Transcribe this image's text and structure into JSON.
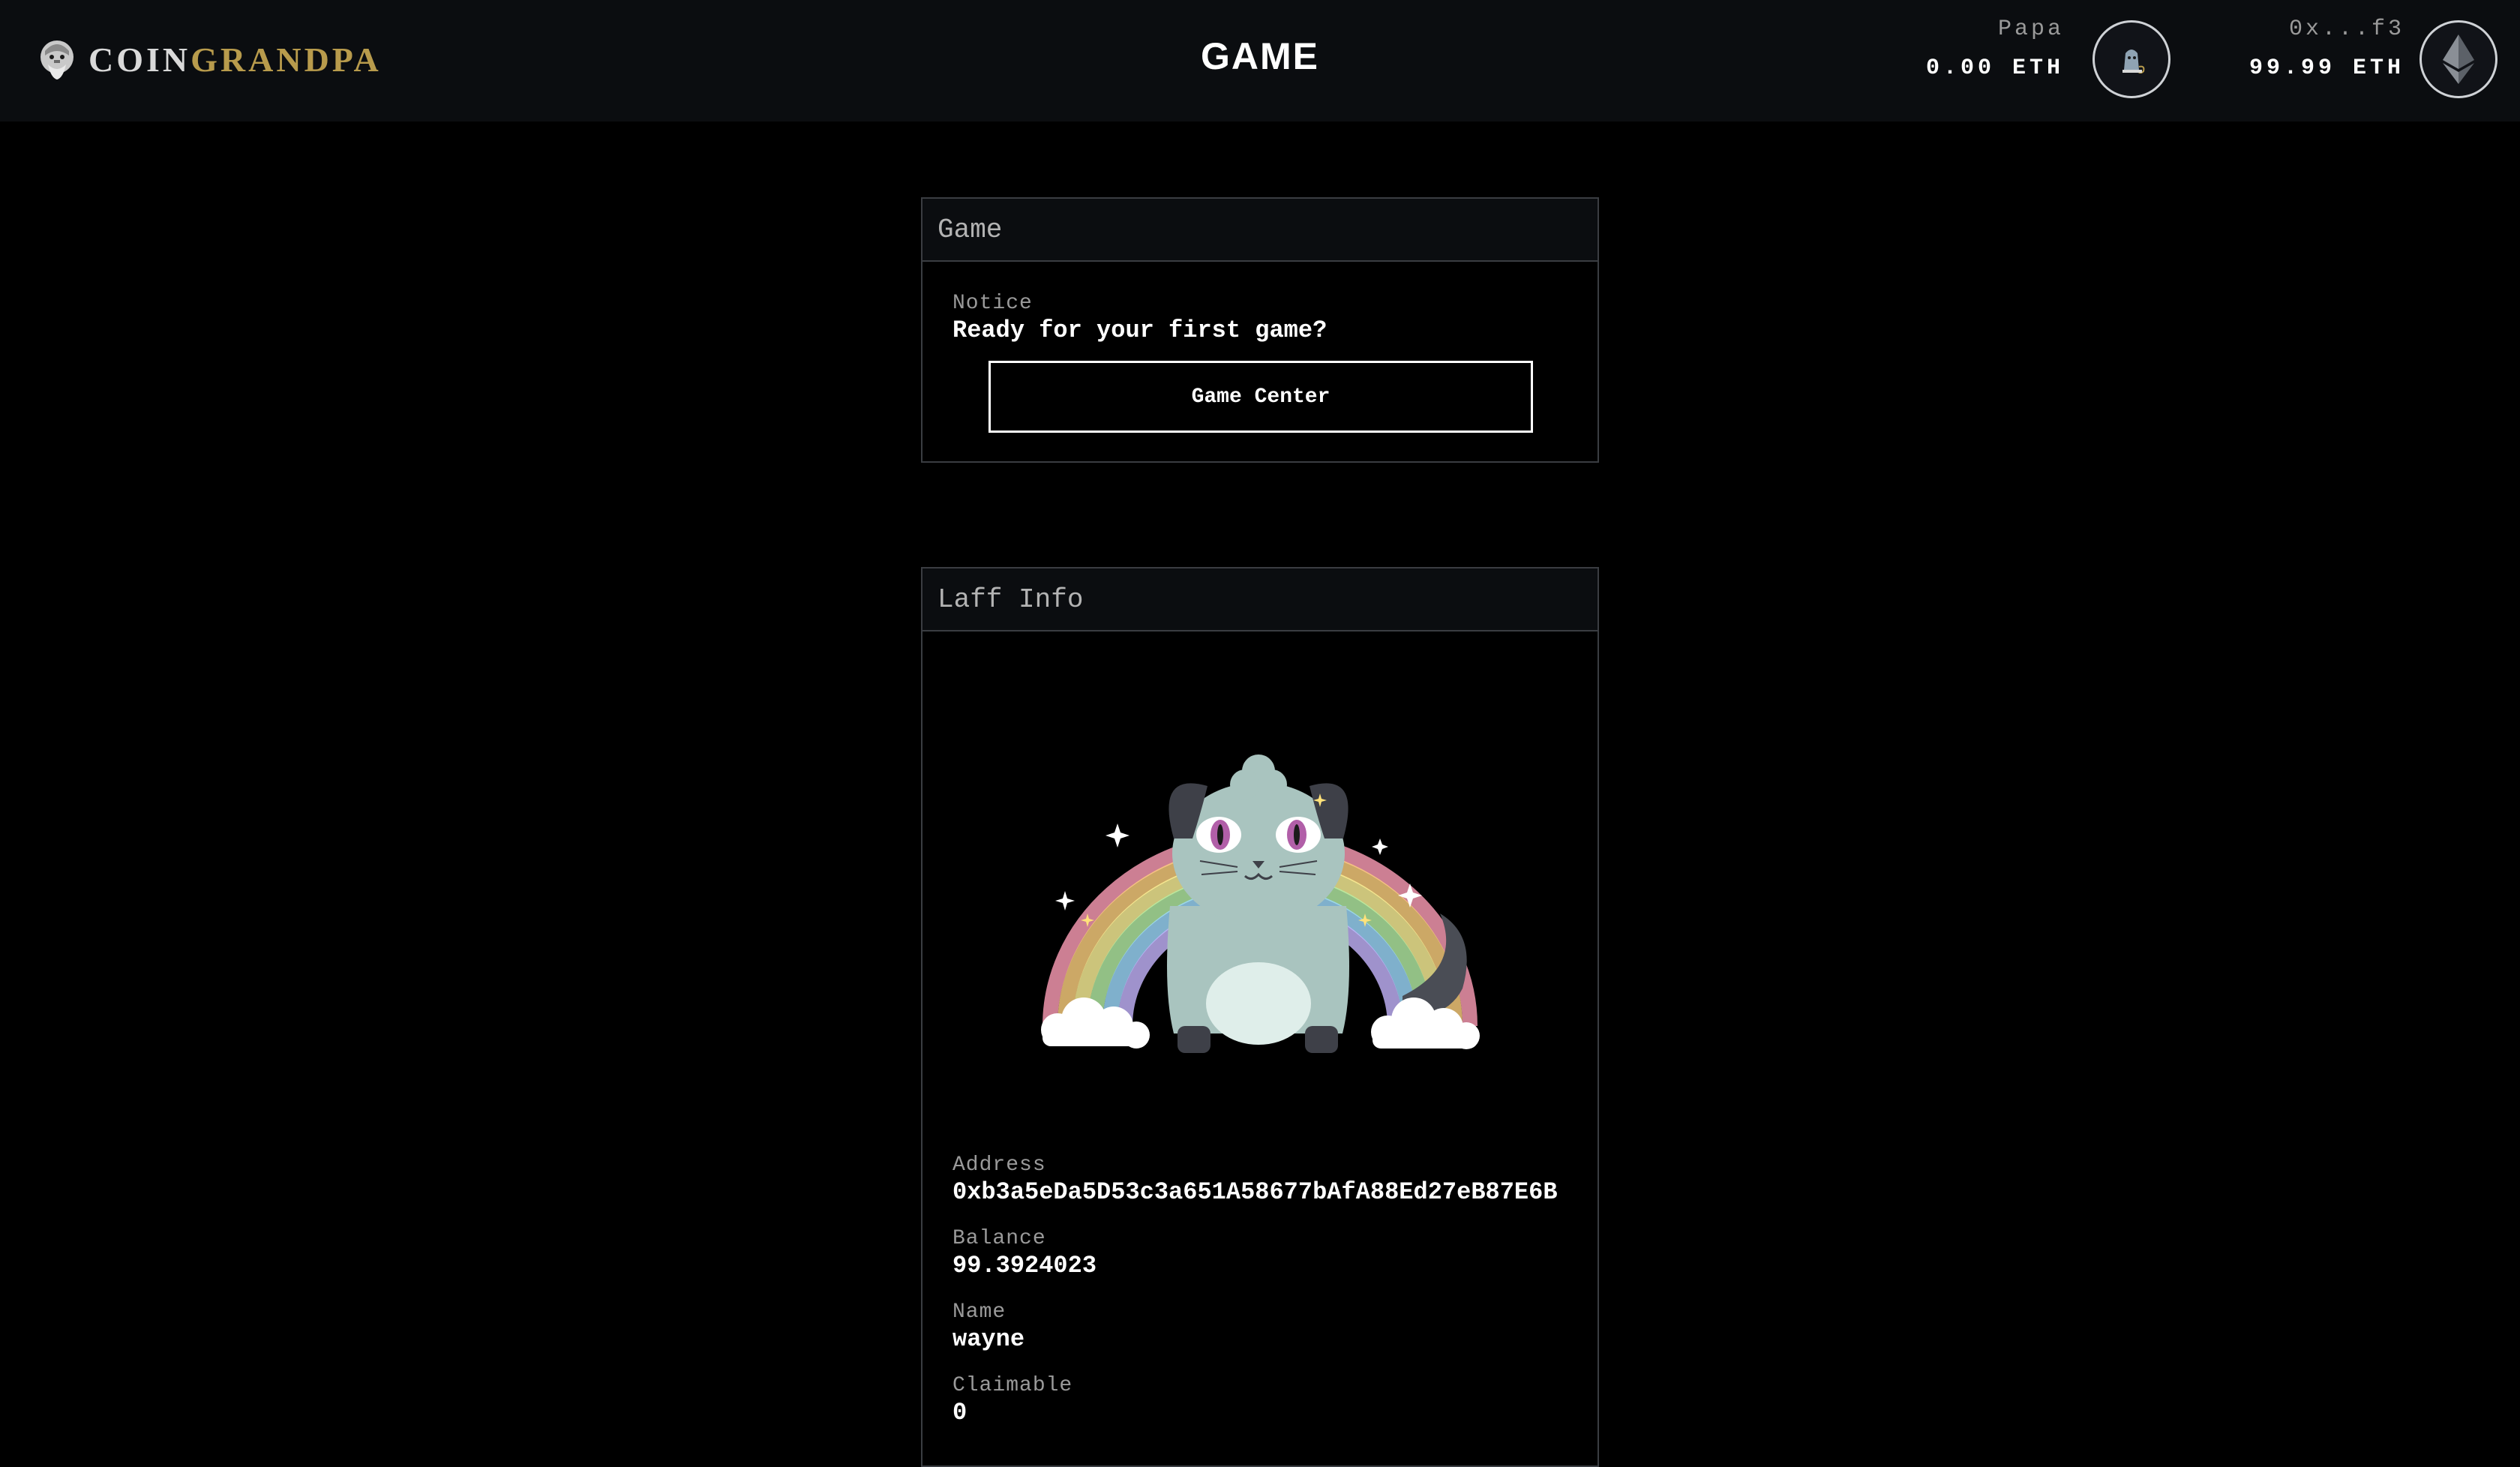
{
  "header": {
    "brand": {
      "part1": "COIN",
      "part2": "GRANDPA"
    },
    "page_title": "GAME",
    "papa_account": {
      "label": "Papa",
      "balance": "0.00 ETH",
      "icon": "papa-avatar-icon"
    },
    "wallet_account": {
      "label": "0x...f3",
      "balance": "99.99 ETH",
      "icon": "ethereum-icon"
    }
  },
  "game_card": {
    "title": "Game",
    "notice_label": "Notice",
    "notice_text": "Ready for your first game?",
    "button_label": "Game Center"
  },
  "laff_card": {
    "title": "Laff Info",
    "image": "laff-kitty-rainbow-image",
    "fields": [
      {
        "label": "Address",
        "value": "0xb3a5eDa5D53c3a651A58677bAfA88Ed27eB87E6B"
      },
      {
        "label": "Balance",
        "value": "99.3924023"
      },
      {
        "label": "Name",
        "value": "wayne"
      },
      {
        "label": "Claimable",
        "value": "0"
      }
    ]
  },
  "colors": {
    "background": "#000000",
    "header_bg": "#0b0d10",
    "brand_gold": "#b89b4c",
    "border": "#3a3d42",
    "muted_text": "#9a9a9a"
  }
}
